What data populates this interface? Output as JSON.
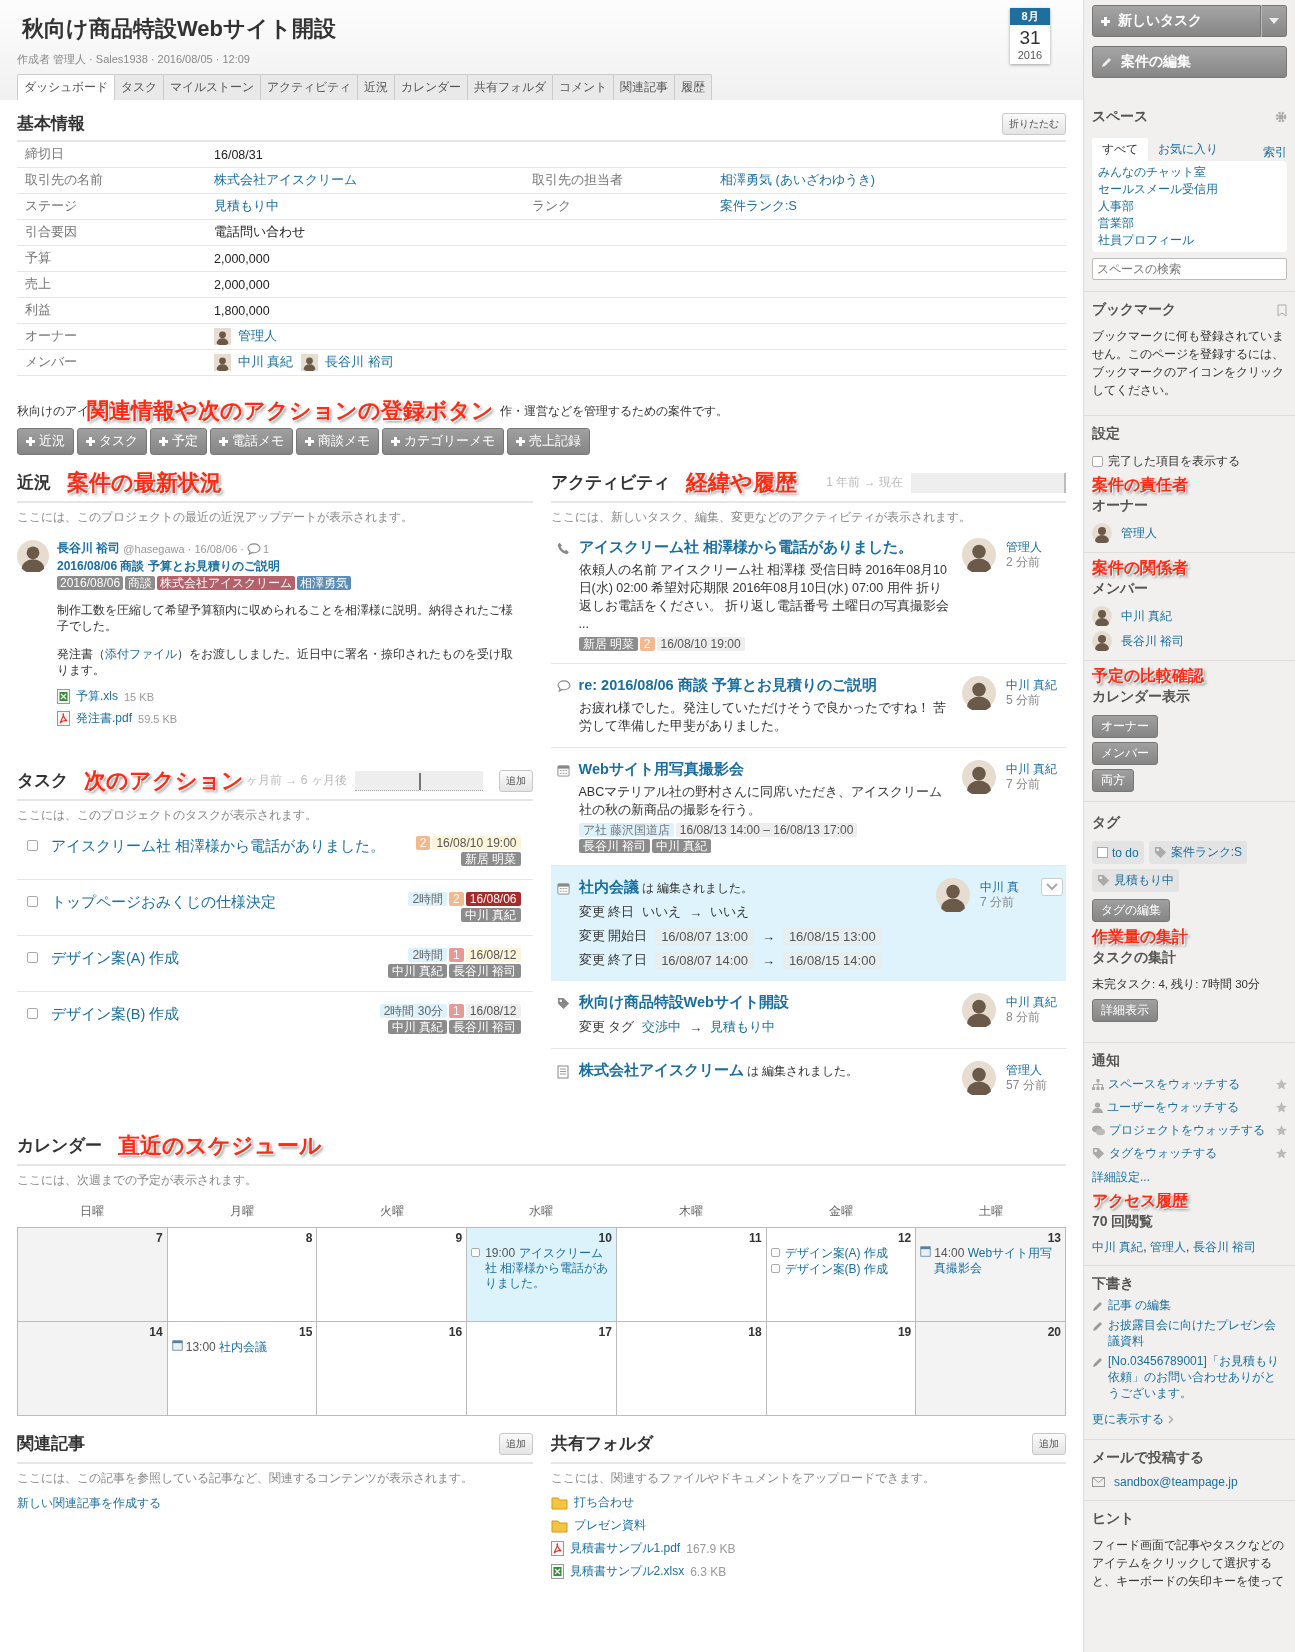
{
  "header": {
    "title": "秋向け商品特設Webサイト開設",
    "meta": "作成者 管理人 · Sales1938 · 2016/08/05 · 12:09",
    "date": {
      "month": "8月",
      "day": "31",
      "year": "2016"
    }
  },
  "tabs": [
    {
      "label": "ダッシュボード",
      "selected": true
    },
    {
      "label": "タスク",
      "selected": false
    },
    {
      "label": "マイルストーン",
      "selected": false
    },
    {
      "label": "アクティビティ",
      "selected": false
    },
    {
      "label": "近況",
      "selected": false
    },
    {
      "label": "カレンダー",
      "selected": false
    },
    {
      "label": "共有フォルダ",
      "selected": false
    },
    {
      "label": "コメント",
      "selected": false
    },
    {
      "label": "関連記事",
      "selected": false
    },
    {
      "label": "履歴",
      "selected": false
    }
  ],
  "basic_info": {
    "title": "基本情報",
    "collapse_button": "折りたたむ",
    "rows": [
      {
        "label": "締切日",
        "value": "16/08/31",
        "kind": "text"
      },
      {
        "label": "取引先の名前",
        "value": "株式会社アイスクリーム",
        "kind": "link",
        "right": {
          "label": "取引先の担当者",
          "value": "相澤勇気 (あいざわゆうき)",
          "kind": "link"
        }
      },
      {
        "label": "ステージ",
        "value": "見積もり中",
        "kind": "link",
        "right": {
          "label": "ランク",
          "value": "案件ランク:S",
          "kind": "link"
        }
      },
      {
        "label": "引合要因",
        "value": "電話問い合わせ",
        "kind": "text"
      },
      {
        "label": "予算",
        "value": "2,000,000",
        "kind": "text"
      },
      {
        "label": "売上",
        "value": "2,000,000",
        "kind": "text"
      },
      {
        "label": "利益",
        "value": "1,800,000",
        "kind": "text"
      },
      {
        "label": "オーナー",
        "kind": "people",
        "people": [
          "管理人"
        ]
      },
      {
        "label": "メンバー",
        "kind": "people",
        "people": [
          "中川 真紀",
          "長谷川 裕司"
        ]
      }
    ]
  },
  "description": {
    "before": "秋向けのアイ",
    "annotation": "関連情報や次のアクションの登録ボタン",
    "after": "作・運営などを管理するための案件です。"
  },
  "add_buttons": [
    "近況",
    "タスク",
    "予定",
    "電話メモ",
    "商談メモ",
    "カテゴリーメモ",
    "売上記録"
  ],
  "updates": {
    "title": "近況",
    "annotation": "案件の最新状況",
    "hint": "ここには、このプロジェクトの最近の近況アップデートが表示されます。",
    "posts": [
      {
        "author": "長谷川 裕司",
        "meta": "@hasegawa · 16/08/06 ·",
        "comments": "1",
        "title": "2016/08/06 商談 予算とお見積りのご説明",
        "tags": [
          {
            "label": "2016/08/06",
            "color": "#8c8c8c"
          },
          {
            "label": "商談",
            "color": "#8c8c8c"
          },
          {
            "label": "株式会社アイスクリーム",
            "color": "#b5616b"
          },
          {
            "label": "相澤勇気",
            "color": "#5b8db5"
          }
        ],
        "paragraphs": [
          {
            "before": "制作工数を圧縮して希望予算額内に収められることを相澤様に説明。納得されたご様子でした。"
          },
          {
            "before": "発注書（",
            "link": "添付ファイル",
            "after": "）をお渡ししました。近日中に署名・捺印されたものを受け取ります。"
          }
        ],
        "attachments": [
          {
            "kind": "xls",
            "name": "予算.xls",
            "size": "15 KB"
          },
          {
            "kind": "pdf",
            "name": "発注書.pdf",
            "size": "59.5 KB"
          }
        ]
      }
    ]
  },
  "tasks": {
    "title": "タスク",
    "annotation": "次のアクション",
    "range": "ヶ月前 → 6 ヶ月後",
    "level": 0.5,
    "add_button": "追加",
    "hint": "ここには、このプロジェクトのタスクが表示されます。",
    "items": [
      {
        "title": "アイスクリーム社 相澤様から電話がありました。",
        "checked": false,
        "priority": {
          "label": "2",
          "color": "#f2b88e"
        },
        "due": {
          "label": "16/08/10 19:00",
          "color": "#fdf5d9"
        },
        "assignees": [
          "新居 明菜"
        ]
      },
      {
        "title": "トップページおみくじの仕様決定",
        "checked": false,
        "estimate": "2時間",
        "priority": {
          "label": "2",
          "color": "#f2b88e"
        },
        "due": {
          "label": "16/08/06",
          "color": "#a82a2a"
        },
        "assignees": [
          "中川 真紀"
        ]
      },
      {
        "title": "デザイン案(A) 作成",
        "checked": false,
        "estimate": "2時間",
        "priority": {
          "label": "1",
          "color": "#e59a98"
        },
        "due": {
          "label": "16/08/12",
          "color": "#fdf5d9"
        },
        "assignees": [
          "中川 真紀",
          "長谷川 裕司"
        ]
      },
      {
        "title": "デザイン案(B) 作成",
        "checked": false,
        "estimate": "2時間 30分",
        "priority": {
          "label": "1",
          "color": "#e59a98"
        },
        "due": {
          "label": "16/08/12",
          "color": "#eeeeee"
        },
        "assignees": [
          "中川 真紀",
          "長谷川 裕司"
        ]
      }
    ]
  },
  "activity": {
    "title": "アクティビティ",
    "annotation": "経緯や履歴",
    "range": "1 年前 → 現在",
    "level": 1,
    "hint": "ここには、新しいタスク、編集、変更などのアクティビティが表示されます。",
    "items": [
      {
        "kind": "call",
        "highlighted": false,
        "title": "アイスクリーム社 相澤様から電話がありました。",
        "body": "依頼人の名前 アイスクリーム社 相澤様 受信日時 2016年08月10日(水) 02:00 希望対応期限 2016年08月10日(水) 07:00 用件 折り返しお電話をください。 折り返し電話番号 土曜日の写真撮影会 ...",
        "tags": [
          {
            "kind": "person",
            "label": "新居 明菜"
          },
          {
            "kind": "priority",
            "label": "2"
          },
          {
            "kind": "date",
            "label": "16/08/10 19:00"
          }
        ],
        "author": "管理人",
        "time": "2 分前"
      },
      {
        "kind": "comment",
        "highlighted": false,
        "title": "re: 2016/08/06 商談 予算とお見積りのご説明",
        "body": "お疲れ様でした。発注していただけそうで良かったですね！ 苦労して準備した甲斐がありました。",
        "author": "中川 真紀",
        "time": "5 分前"
      },
      {
        "kind": "event",
        "highlighted": false,
        "title": "Webサイト用写真撮影会",
        "body": "ABCマテリアル社の野村さんに同席いただき、アイスクリーム社の秋の新商品の撮影を行う。",
        "tags": [
          {
            "kind": "place",
            "label": "ア社 藤沢国道店"
          },
          {
            "kind": "date",
            "label": "16/08/13 14:00 – 16/08/13 17:00"
          },
          {
            "kind": "person",
            "label": "長谷川 裕司"
          },
          {
            "kind": "person",
            "label": "中川 真紀"
          }
        ],
        "author": "中川 真紀",
        "time": "7 分前"
      },
      {
        "kind": "event",
        "highlighted": true,
        "title": "社内会議",
        "suffix": "は 編集されました。",
        "changes": [
          {
            "kind": "plain",
            "label": "変更 終日",
            "from": "いいえ",
            "arrow": "→",
            "to": "いいえ"
          },
          {
            "kind": "boxed",
            "label": "変更 開始日",
            "from": "16/08/07 13:00",
            "arrow": "→",
            "to": "16/08/15 13:00"
          },
          {
            "kind": "boxed",
            "label": "変更 終了日",
            "from": "16/08/07 14:00",
            "arrow": "→",
            "to": "16/08/15 14:00"
          }
        ],
        "author": "中川 真",
        "time": "7 分前"
      },
      {
        "kind": "tag",
        "highlighted": false,
        "title": "秋向け商品特設Webサイト開設",
        "changes": [
          {
            "kind": "link",
            "label": "変更 タグ",
            "from": "交渉中",
            "arrow": "→",
            "to": "見積もり中"
          }
        ],
        "author": "中川 真紀",
        "time": "8 分前"
      },
      {
        "kind": "record",
        "highlighted": false,
        "title": "株式会社アイスクリーム",
        "suffix": "は 編集されました。",
        "author": "管理人",
        "time": "57 分前"
      }
    ]
  },
  "calendar": {
    "title": "カレンダー",
    "annotation": "直近のスケジュール",
    "hint": "ここには、次週までの予定が表示されます。",
    "weekdays": [
      "日曜",
      "月曜",
      "火曜",
      "水曜",
      "木曜",
      "金曜",
      "土曜"
    ],
    "weeks": [
      [
        {
          "day": "7",
          "weekend": true,
          "today": false
        },
        {
          "day": "8",
          "weekend": false,
          "today": false
        },
        {
          "day": "9",
          "weekend": false,
          "today": false
        },
        {
          "day": "10",
          "weekend": false,
          "today": true,
          "events": [
            {
              "kind": "task",
              "time": "19:00",
              "title": "アイスクリーム社 相澤様から電話がありました。"
            }
          ]
        },
        {
          "day": "11",
          "weekend": false,
          "today": false
        },
        {
          "day": "12",
          "weekend": false,
          "today": false,
          "events": [
            {
              "kind": "task",
              "title": "デザイン案(A) 作成"
            },
            {
              "kind": "task",
              "title": "デザイン案(B) 作成"
            }
          ]
        },
        {
          "day": "13",
          "weekend": true,
          "today": false,
          "events": [
            {
              "kind": "event",
              "time": "14:00",
              "title": "Webサイト用写真撮影会"
            }
          ]
        }
      ],
      [
        {
          "day": "14",
          "weekend": true,
          "today": false
        },
        {
          "day": "15",
          "weekend": false,
          "today": false,
          "events": [
            {
              "kind": "event",
              "time": "13:00",
              "title": "社内会議"
            }
          ]
        },
        {
          "day": "16",
          "weekend": false,
          "today": false
        },
        {
          "day": "17",
          "weekend": false,
          "today": false
        },
        {
          "day": "18",
          "weekend": false,
          "today": false
        },
        {
          "day": "19",
          "weekend": false,
          "today": false
        },
        {
          "day": "20",
          "weekend": true,
          "today": false
        }
      ]
    ]
  },
  "related": {
    "title": "関連記事",
    "add_button": "追加",
    "hint": "ここには、この記事を参照している記事など、関連するコンテンツが表示されます。",
    "link": "新しい関連記事を作成する"
  },
  "shared_folder": {
    "title": "共有フォルダ",
    "add_button": "追加",
    "hint": "ここには、関連するファイルやドキュメントをアップロードできます。",
    "items": [
      {
        "kind": "folder",
        "name": "打ち合わせ"
      },
      {
        "kind": "folder",
        "name": "プレゼン資料"
      },
      {
        "kind": "pdf",
        "name": "見積書サンプル1.pdf",
        "size": "167.9 KB"
      },
      {
        "kind": "xls",
        "name": "見積書サンプル2.xlsx",
        "size": "6.3 KB"
      }
    ]
  },
  "sidebar": {
    "new_task_button": "新しいタスク",
    "edit_button": "案件の編集",
    "spaces": {
      "title": "スペース",
      "tabs": [
        {
          "label": "すべて",
          "selected": true
        },
        {
          "label": "お気に入り",
          "selected": false
        }
      ],
      "index_link": "索引",
      "items": [
        "みんなのチャット室",
        "セールスメール受信用",
        "人事部",
        "営業部",
        "社員プロフィール"
      ],
      "search_placeholder": "スペースの検索"
    },
    "bookmarks": {
      "title": "ブックマーク",
      "text": "ブックマークに何も登録されていません。このページを登録するには、ブックマークのアイコンをクリックしてください。"
    },
    "settings": {
      "title": "設定",
      "option": {
        "label": "完了した項目を表示する",
        "checked": false
      }
    },
    "owner": {
      "annotation": "案件の責任者",
      "title": "オーナー",
      "people": [
        "管理人"
      ]
    },
    "members": {
      "annotation": "案件の関係者",
      "title": "メンバー",
      "people": [
        "中川 真紀",
        "長谷川 裕司"
      ]
    },
    "calendar_view": {
      "annotation": "予定の比較確認",
      "title": "カレンダー表示",
      "buttons": [
        "オーナー",
        "メンバー",
        "両方"
      ]
    },
    "tags": {
      "title": "タグ",
      "items": [
        {
          "kind": "todo",
          "label": "to do"
        },
        {
          "kind": "tag",
          "label": "案件ランク:S"
        },
        {
          "kind": "tag",
          "label": "見積もり中"
        }
      ],
      "edit_button": "タグの編集"
    },
    "task_summary": {
      "annotation": "作業量の集計",
      "title": "タスクの集計",
      "text": "未完タスク: 4, 残り: 7時間 30分",
      "button": "詳細表示"
    },
    "notifications": {
      "title": "通知",
      "items": [
        {
          "kind": "space",
          "label": "スペースをウォッチする"
        },
        {
          "kind": "user",
          "label": "ユーザーをウォッチする"
        },
        {
          "kind": "project",
          "label": "プロジェクトをウォッチする"
        },
        {
          "kind": "tag",
          "label": "タグをウォッチする"
        }
      ],
      "settings_link": "詳細設定..."
    },
    "views": {
      "annotation": "アクセス履歴",
      "title": "70 回閲覧",
      "separator": ",",
      "viewers": [
        "中川 真紀",
        "管理人",
        "長谷川 裕司"
      ]
    },
    "drafts": {
      "title": "下書き",
      "items": [
        "記事 の編集",
        "お披露目会に向けたプレゼン会議資料",
        "[No.03456789001]「お見積もり依頼」のお問い合わせありがとうございます。"
      ],
      "more_link": "更に表示する"
    },
    "mail": {
      "title": "メールで投稿する",
      "address": "sandbox@teampage.jp"
    },
    "hint": {
      "title": "ヒント",
      "text": "フィード画面で記事やタスクなどのアイテムをクリックして選択すると、キーボードの矢印キーを使って"
    }
  }
}
